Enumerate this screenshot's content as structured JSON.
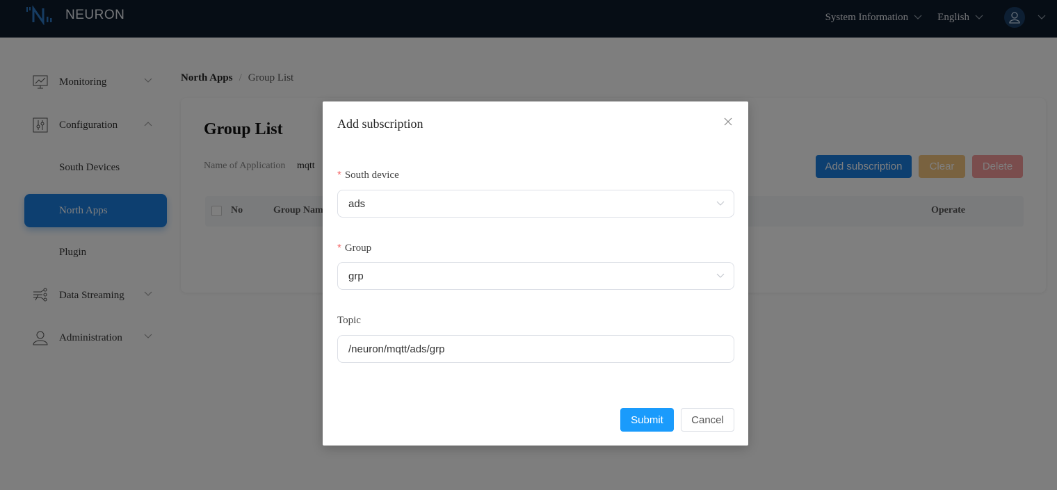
{
  "header": {
    "brand": "NEURON",
    "system_info": "System Information",
    "language": "English",
    "icons": {
      "logo": "neuron-logo-icon",
      "user": "user-icon",
      "chevron": "chevron-down-icon"
    }
  },
  "sidebar": {
    "items": [
      {
        "label": "Monitoring",
        "icon": "monitor-chart-icon",
        "expanded": false
      },
      {
        "label": "Configuration",
        "icon": "sliders-icon",
        "expanded": true
      },
      {
        "label": "South Devices",
        "sub": true
      },
      {
        "label": "North Apps",
        "sub": true,
        "active": true
      },
      {
        "label": "Plugin",
        "sub": true
      },
      {
        "label": "Data Streaming",
        "icon": "data-stream-icon",
        "expanded": false
      },
      {
        "label": "Administration",
        "icon": "user-icon",
        "expanded": false
      }
    ]
  },
  "breadcrumb": {
    "parent": "North Apps",
    "separator": "/",
    "current": "Group List"
  },
  "page": {
    "title": "Group List",
    "app_label": "Name of Application",
    "app_value": "mqtt",
    "buttons": {
      "add": "Add subscription",
      "clear": "Clear",
      "delete": "Delete"
    },
    "table": {
      "columns": [
        "No",
        "Group Name",
        "Operate"
      ],
      "rows": []
    }
  },
  "modal": {
    "title": "Add subscription",
    "fields": {
      "south_device": {
        "label": "South device",
        "required": true,
        "value": "ads"
      },
      "group": {
        "label": "Group",
        "required": true,
        "value": "grp"
      },
      "topic": {
        "label": "Topic",
        "required": false,
        "value": "/neuron/mqtt/ads/grp"
      }
    },
    "submit": "Submit",
    "cancel": "Cancel"
  },
  "colors": {
    "primary": "#1b7ee0",
    "submit": "#1a9bfc",
    "header_bg": "#0d1a2b",
    "clear": "#f2c47e",
    "delete": "#f59b9b",
    "required": "#f56c6c"
  }
}
